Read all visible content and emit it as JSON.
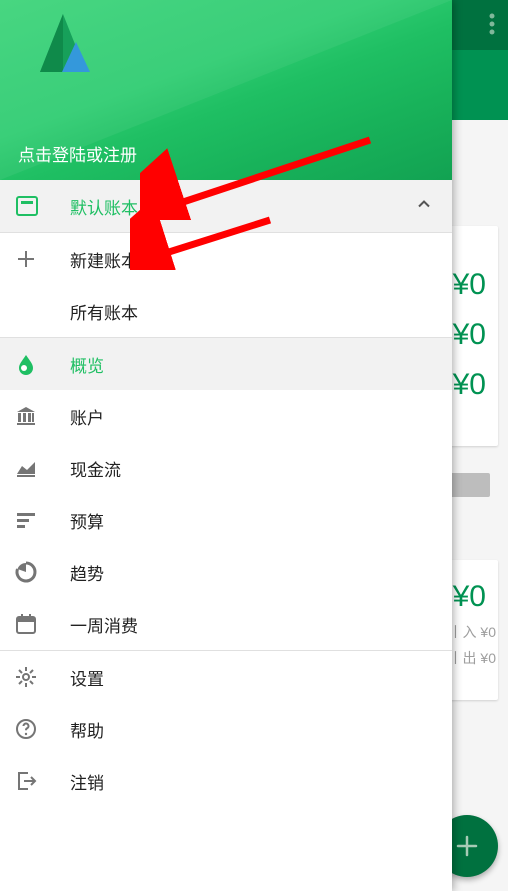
{
  "drawer": {
    "login_text": "点击登陆或注册",
    "ledger": {
      "default": "默认账本",
      "new": "新建账本",
      "all": "所有账本"
    },
    "nav": {
      "overview": "概览",
      "accounts": "账户",
      "cashflow": "现金流",
      "budget": "预算",
      "trend": "趋势",
      "weekly": "一周消费"
    },
    "footer": {
      "settings": "设置",
      "help": "帮助",
      "logout": "注销"
    }
  },
  "bg": {
    "v1": "¥0",
    "v2": "¥0",
    "v3": "¥0",
    "v4": "¥0",
    "income": "丨入 ¥0",
    "expense": "丨出 ¥0"
  },
  "colors": {
    "accent": "#1fbf63",
    "accent_dark": "#00713f"
  }
}
